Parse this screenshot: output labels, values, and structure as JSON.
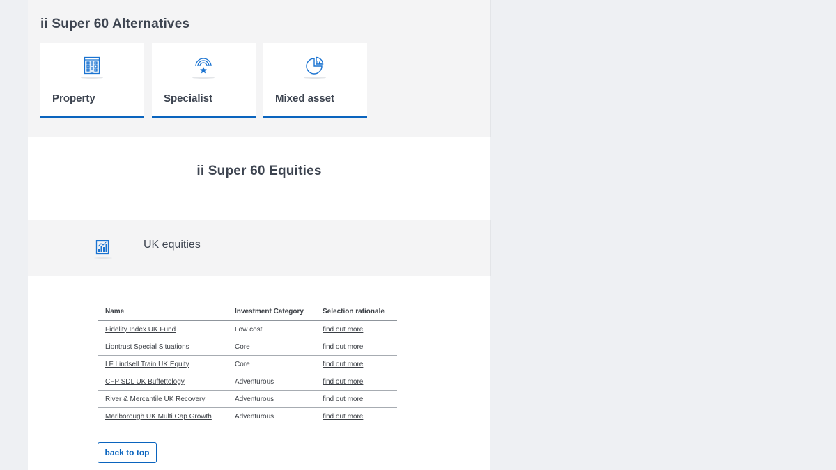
{
  "alternatives": {
    "title": "ii Super 60 Alternatives",
    "cards": [
      {
        "label": "Property",
        "icon": "building-icon"
      },
      {
        "label": "Specialist",
        "icon": "signal-star-icon"
      },
      {
        "label": "Mixed asset",
        "icon": "pie-chart-icon"
      }
    ]
  },
  "equities": {
    "title": "ii Super 60 Equities",
    "section": {
      "label": "UK equities",
      "icon": "bar-chart-icon"
    }
  },
  "table": {
    "headers": [
      "Name",
      "Investment Category",
      "Selection rationale"
    ],
    "rows": [
      {
        "name": "Fidelity Index UK Fund",
        "category": "Low cost",
        "rationale": "find out more"
      },
      {
        "name": "Liontrust Special Situations",
        "category": "Core",
        "rationale": "find out more"
      },
      {
        "name": "LF Lindsell Train UK Equity",
        "category": "Core",
        "rationale": "find out more"
      },
      {
        "name": "CFP SDL UK Buffettology",
        "category": "Adventurous",
        "rationale": "find out more"
      },
      {
        "name": "River & Mercantile UK Recovery",
        "category": "Adventurous",
        "rationale": "find out more"
      },
      {
        "name": "Marlborough UK Multi Cap Growth",
        "category": "Adventurous",
        "rationale": "find out more"
      }
    ]
  },
  "back_to_top_label": "back to top",
  "colors": {
    "accent": "#0a64be",
    "band_bg": "#f4f4f5",
    "page_bg": "#eef0f3"
  }
}
